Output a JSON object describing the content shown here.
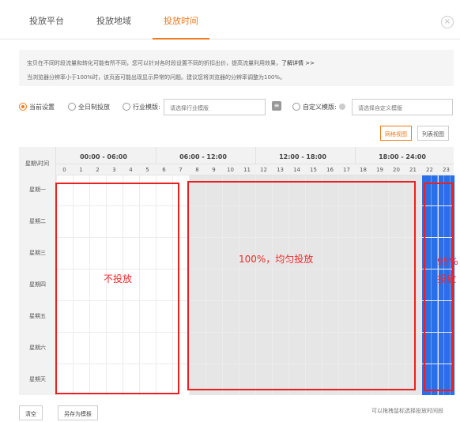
{
  "tabs": [
    "投放平台",
    "投放地域",
    "投放时间"
  ],
  "close_icon_glyph": "×",
  "notice": {
    "line1": "宝贝在不同时段流量和转化可能有所不同，您可以针对各时段设置不同的折扣出价，提高流量利用效果，",
    "link": "了解详情 >>",
    "line2": "当浏览器分辨率小于100%时，该页面可能出现显示异常的问题。建议您将浏览器的分辨率调整为100%。"
  },
  "options": {
    "current": "当前设置",
    "all_day": "全日制投放",
    "industry": "行业模版:",
    "industry_placeholder": "请选择行业模版",
    "custom": "自定义模版:",
    "custom_placeholder": "请选择自定义模版"
  },
  "view": {
    "grid": "网格视图",
    "list": "列表视图"
  },
  "grid": {
    "corner": "星期\\时间",
    "ranges": [
      "00:00 - 06:00",
      "06:00 - 12:00",
      "12:00 - 18:00",
      "18:00 - 24:00"
    ],
    "hours": [
      "0",
      "1",
      "2",
      "3",
      "4",
      "5",
      "6",
      "7",
      "8",
      "9",
      "10",
      "11",
      "12",
      "13",
      "14",
      "15",
      "16",
      "17",
      "18",
      "19",
      "20",
      "21",
      "22",
      "23"
    ],
    "days": [
      "星期一",
      "星期二",
      "星期三",
      "星期四",
      "星期五",
      "星期六",
      "星期天"
    ],
    "fills": {
      "gray_hours": [
        8,
        21
      ],
      "blue_hours": [
        22,
        23
      ],
      "blue_color": "#2a6ee8"
    }
  },
  "annotations": {
    "left": "不投放",
    "middle": "100%，均匀投放",
    "right_line1": "95%",
    "right_line2": "投放",
    "color": "#ee2a2a"
  },
  "footer": {
    "clear": "清空",
    "save_as": "另存为模板",
    "hint": "可以拖拽鼠标选择投放时间段"
  }
}
